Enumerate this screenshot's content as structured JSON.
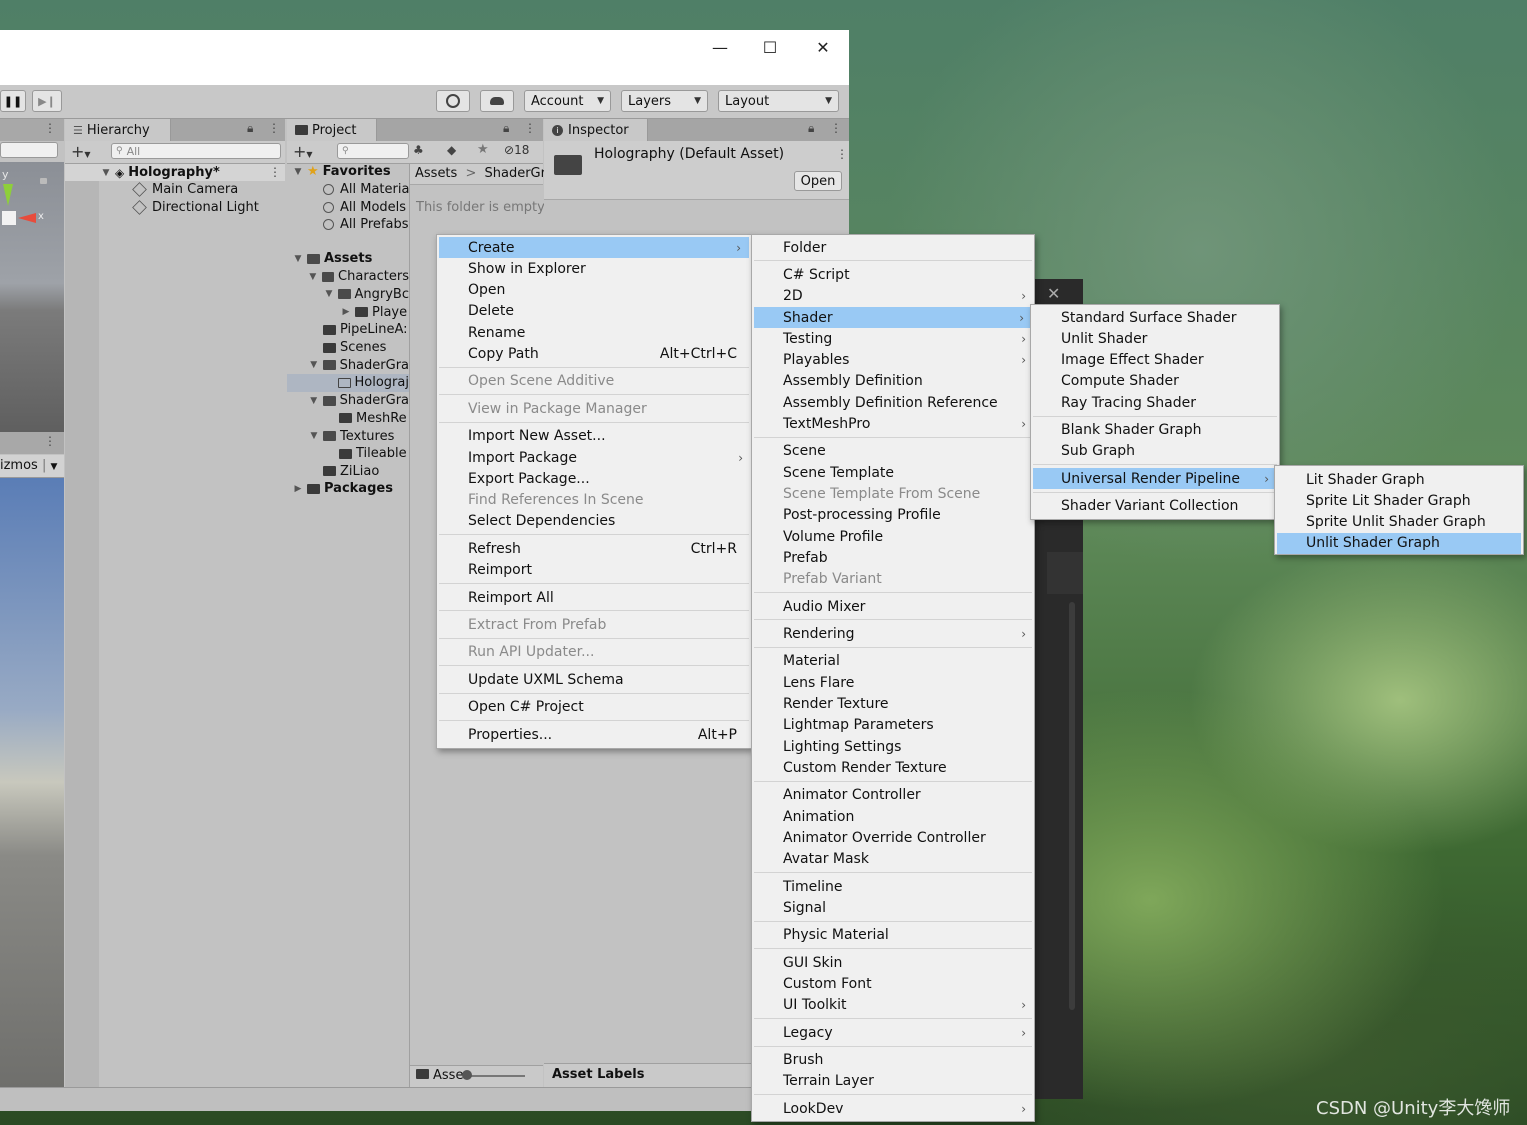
{
  "window": {
    "minimize_glyph": "—",
    "maximize_glyph": "☐",
    "close_glyph": "✕"
  },
  "toolbar": {
    "account": "Account",
    "layers": "Layers",
    "layout": "Layout"
  },
  "scene_view": {
    "gizmos": "izmos",
    "y_axis": "y",
    "x_axis": "x"
  },
  "hierarchy": {
    "tab": "Hierarchy",
    "search_placeholder": "All",
    "scene": "Holography*",
    "items": [
      "Main Camera",
      "Directional Light"
    ]
  },
  "project": {
    "tab": "Project",
    "hidden_count": "18",
    "favorites": "Favorites",
    "favorite_items": [
      "All Materia",
      "All Models",
      "All Prefabs"
    ],
    "assets": "Assets",
    "tree": [
      {
        "label": "Characters",
        "indent": 1,
        "open": true
      },
      {
        "label": "AngryBc",
        "indent": 2,
        "open": true
      },
      {
        "label": "Playe",
        "indent": 3,
        "open": false
      },
      {
        "label": "PipeLineA:",
        "indent": 1,
        "open": null
      },
      {
        "label": "Scenes",
        "indent": 1,
        "open": null
      },
      {
        "label": "ShaderGra",
        "indent": 1,
        "open": true
      },
      {
        "label": "Holograj",
        "indent": 2,
        "open": null,
        "selected": true
      },
      {
        "label": "ShaderGra",
        "indent": 1,
        "open": true
      },
      {
        "label": "MeshRe",
        "indent": 2,
        "open": null
      },
      {
        "label": "Textures",
        "indent": 1,
        "open": true
      },
      {
        "label": "Tileable",
        "indent": 2,
        "open": null
      },
      {
        "label": "ZiLiao",
        "indent": 1,
        "open": null
      }
    ],
    "packages": "Packages",
    "breadcrumb_root": "Assets",
    "breadcrumb_sep": ">",
    "breadcrumb_child": "ShaderGra",
    "empty_text": "This folder is empty",
    "footer": "Asse"
  },
  "inspector": {
    "tab": "Inspector",
    "title": "Holography (Default Asset)",
    "open_button": "Open",
    "asset_labels": "Asset Labels"
  },
  "context_menu": {
    "items": [
      {
        "label": "Create",
        "arrow": true,
        "selected": true
      },
      {
        "label": "Show in Explorer"
      },
      {
        "label": "Open"
      },
      {
        "label": "Delete"
      },
      {
        "label": "Rename"
      },
      {
        "label": "Copy Path",
        "shortcut": "Alt+Ctrl+C"
      },
      {
        "sep": true
      },
      {
        "label": "Open Scene Additive",
        "disabled": true
      },
      {
        "sep": true
      },
      {
        "label": "View in Package Manager",
        "disabled": true
      },
      {
        "sep": true
      },
      {
        "label": "Import New Asset..."
      },
      {
        "label": "Import Package",
        "arrow": true
      },
      {
        "label": "Export Package..."
      },
      {
        "label": "Find References In Scene",
        "disabled": true
      },
      {
        "label": "Select Dependencies"
      },
      {
        "sep": true
      },
      {
        "label": "Refresh",
        "shortcut": "Ctrl+R"
      },
      {
        "label": "Reimport"
      },
      {
        "sep": true
      },
      {
        "label": "Reimport All"
      },
      {
        "sep": true
      },
      {
        "label": "Extract From Prefab",
        "disabled": true
      },
      {
        "sep": true
      },
      {
        "label": "Run API Updater...",
        "disabled": true
      },
      {
        "sep": true
      },
      {
        "label": "Update UXML Schema"
      },
      {
        "sep": true
      },
      {
        "label": "Open C# Project"
      },
      {
        "sep": true
      },
      {
        "label": "Properties...",
        "shortcut": "Alt+P"
      }
    ]
  },
  "create_menu": {
    "items": [
      {
        "label": "Folder"
      },
      {
        "sep": true
      },
      {
        "label": "C# Script"
      },
      {
        "label": "2D",
        "arrow": true
      },
      {
        "label": "Shader",
        "arrow": true,
        "selected": true
      },
      {
        "label": "Testing",
        "arrow": true
      },
      {
        "label": "Playables",
        "arrow": true
      },
      {
        "label": "Assembly Definition"
      },
      {
        "label": "Assembly Definition Reference"
      },
      {
        "label": "TextMeshPro",
        "arrow": true
      },
      {
        "sep": true
      },
      {
        "label": "Scene"
      },
      {
        "label": "Scene Template"
      },
      {
        "label": "Scene Template From Scene",
        "disabled": true
      },
      {
        "label": "Post-processing Profile"
      },
      {
        "label": "Volume Profile"
      },
      {
        "label": "Prefab"
      },
      {
        "label": "Prefab Variant",
        "disabled": true
      },
      {
        "sep": true
      },
      {
        "label": "Audio Mixer"
      },
      {
        "sep": true
      },
      {
        "label": "Rendering",
        "arrow": true
      },
      {
        "sep": true
      },
      {
        "label": "Material"
      },
      {
        "label": "Lens Flare"
      },
      {
        "label": "Render Texture"
      },
      {
        "label": "Lightmap Parameters"
      },
      {
        "label": "Lighting Settings"
      },
      {
        "label": "Custom Render Texture"
      },
      {
        "sep": true
      },
      {
        "label": "Animator Controller"
      },
      {
        "label": "Animation"
      },
      {
        "label": "Animator Override Controller"
      },
      {
        "label": "Avatar Mask"
      },
      {
        "sep": true
      },
      {
        "label": "Timeline"
      },
      {
        "label": "Signal"
      },
      {
        "sep": true
      },
      {
        "label": "Physic Material"
      },
      {
        "sep": true
      },
      {
        "label": "GUI Skin"
      },
      {
        "label": "Custom Font"
      },
      {
        "label": "UI Toolkit",
        "arrow": true
      },
      {
        "sep": true
      },
      {
        "label": "Legacy",
        "arrow": true
      },
      {
        "sep": true
      },
      {
        "label": "Brush"
      },
      {
        "label": "Terrain Layer"
      },
      {
        "sep": true
      },
      {
        "label": "LookDev",
        "arrow": true
      }
    ]
  },
  "shader_menu": {
    "items": [
      {
        "label": "Standard Surface Shader"
      },
      {
        "label": "Unlit Shader"
      },
      {
        "label": "Image Effect Shader"
      },
      {
        "label": "Compute Shader"
      },
      {
        "label": "Ray Tracing Shader"
      },
      {
        "sep": true
      },
      {
        "label": "Blank Shader Graph"
      },
      {
        "label": "Sub Graph"
      },
      {
        "sep": true
      },
      {
        "label": "Universal Render Pipeline",
        "arrow": true,
        "selected": true
      },
      {
        "sep": true
      },
      {
        "label": "Shader Variant Collection"
      }
    ]
  },
  "urp_menu": {
    "items": [
      {
        "label": "Lit Shader Graph"
      },
      {
        "label": "Sprite Lit Shader Graph"
      },
      {
        "label": "Sprite Unlit Shader Graph"
      },
      {
        "label": "Unlit Shader Graph",
        "selected": true
      }
    ]
  },
  "watermark": "CSDN @Unity李大馋师",
  "colors": {
    "selection": "#99c9f4",
    "menu_bg": "#f0f0f0",
    "panel_bg": "#c2c2c2"
  }
}
